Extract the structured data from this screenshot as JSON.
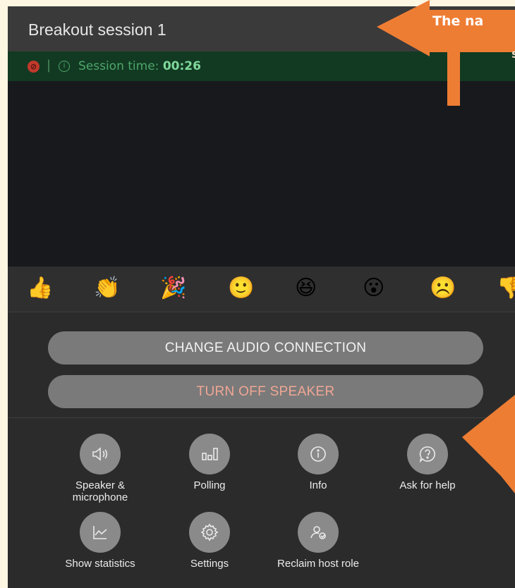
{
  "header": {
    "title": "Breakout session 1"
  },
  "status": {
    "session_label": "Session time:",
    "session_time": "00:26"
  },
  "reactions": [
    "👍",
    "👏",
    "🎉",
    "🙂",
    "😆",
    "😮",
    "☹️",
    "👎"
  ],
  "buttons": {
    "change_audio": "CHANGE AUDIO CONNECTION",
    "turn_off_speaker": "TURN OFF SPEAKER"
  },
  "menu": [
    {
      "label": "Speaker & microphone",
      "icon": "speaker-icon"
    },
    {
      "label": "Polling",
      "icon": "polling-icon"
    },
    {
      "label": "Info",
      "icon": "info-icon"
    },
    {
      "label": "Ask for help",
      "icon": "help-icon"
    },
    {
      "label": "Show statistics",
      "icon": "statistics-icon"
    },
    {
      "label": "Settings",
      "icon": "gear-icon"
    },
    {
      "label": "Reclaim host role",
      "icon": "reclaim-host-icon"
    }
  ],
  "annotation": {
    "text_line1": "The na",
    "text_line2": "s"
  },
  "colors": {
    "annotation_orange": "#ee7d34",
    "status_green": "#4ea66a",
    "speaker_off_text": "#f0a694"
  }
}
